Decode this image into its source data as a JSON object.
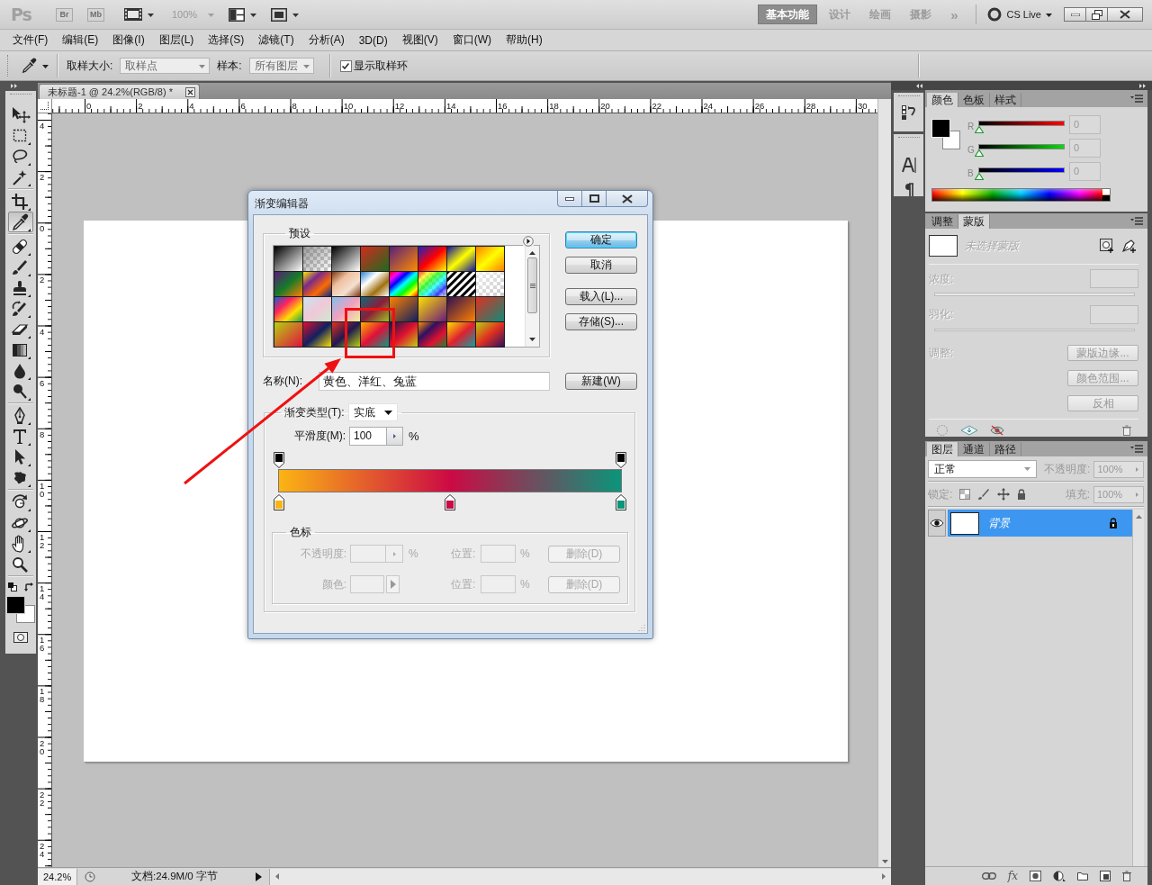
{
  "app_bar": {
    "logo": "Ps",
    "bridge_button": "Br",
    "mini_bridge_button": "Mb",
    "zoom": "100%",
    "workspaces": [
      {
        "label": "基本功能",
        "selected": true
      },
      {
        "label": "设计",
        "selected": false
      },
      {
        "label": "绘画",
        "selected": false
      },
      {
        "label": "摄影",
        "selected": false
      }
    ],
    "more_workspaces": "»",
    "cs_live": "CS Live"
  },
  "menu_bar": [
    "文件(F)",
    "编辑(E)",
    "图像(I)",
    "图层(L)",
    "选择(S)",
    "滤镜(T)",
    "分析(A)",
    "3D(D)",
    "视图(V)",
    "窗口(W)",
    "帮助(H)"
  ],
  "options_bar": {
    "sample_size_label": "取样大小:",
    "sample_size": "取样点",
    "sample_label": "样本:",
    "sample": "所有图层",
    "show_ring": {
      "label": "显示取样环",
      "checked": true
    }
  },
  "tool_groups": [
    {
      "tools": [
        {
          "kind": "move",
          "selected": false
        },
        {
          "kind": "marquee",
          "selected": false
        },
        {
          "kind": "lasso",
          "selected": false
        },
        {
          "kind": "wand",
          "selected": false
        }
      ]
    },
    {
      "tools": [
        {
          "kind": "crop",
          "selected": false
        },
        {
          "kind": "eyedropper",
          "selected": true
        }
      ]
    },
    {
      "tools": [
        {
          "kind": "healing",
          "selected": false
        },
        {
          "kind": "brush",
          "selected": false
        },
        {
          "kind": "stamp",
          "selected": false
        },
        {
          "kind": "history",
          "selected": false
        },
        {
          "kind": "eraser",
          "selected": false
        },
        {
          "kind": "gradient",
          "selected": false
        },
        {
          "kind": "blur",
          "selected": false
        },
        {
          "kind": "dodge",
          "selected": false
        }
      ]
    },
    {
      "tools": [
        {
          "kind": "pen",
          "selected": false
        },
        {
          "kind": "type",
          "selected": false
        },
        {
          "kind": "select",
          "selected": false
        },
        {
          "kind": "shape",
          "selected": false
        }
      ]
    },
    {
      "tools": [
        {
          "kind": "rotate",
          "selected": false
        },
        {
          "kind": "orbit",
          "selected": false
        },
        {
          "kind": "hand",
          "selected": false
        },
        {
          "kind": "zoom",
          "selected": false
        }
      ]
    }
  ],
  "document": {
    "tab_title": "未标题-1 @ 24.2%(RGB/8) *",
    "h_ruler": [
      "0",
      "2",
      "4",
      "6",
      "8",
      "10",
      "12",
      "14",
      "16",
      "18",
      "20",
      "22",
      "24",
      "26",
      "28",
      "30"
    ],
    "v_ruler": [
      "4",
      "2",
      "0",
      "2",
      "4",
      "6",
      "8",
      "10",
      "12",
      "14",
      "16",
      "18",
      "20",
      "22",
      "24"
    ]
  },
  "status_bar": {
    "zoom": "24.2%",
    "info": "文档:24.9M/0 字节"
  },
  "color_panel": {
    "tabs": [
      {
        "label": "颜色",
        "selected": true
      },
      {
        "label": "色板",
        "selected": false
      },
      {
        "label": "样式",
        "selected": false
      }
    ],
    "channels": [
      {
        "kind": "red",
        "label": "R",
        "value": "0",
        "level": 0
      },
      {
        "kind": "green",
        "label": "G",
        "value": "0",
        "level": 0
      },
      {
        "kind": "blue",
        "label": "B",
        "value": "0",
        "level": 0
      }
    ]
  },
  "masks_panel": {
    "tabs": [
      {
        "label": "调整",
        "selected": false
      },
      {
        "label": "蒙版",
        "selected": true
      }
    ],
    "disabled": true,
    "status": "未选择蒙版",
    "density_label": "浓度:",
    "feather_label": "羽化:",
    "refine_label": "调整:",
    "buttons": [
      "蒙版边缘...",
      "颜色范围...",
      "反相"
    ]
  },
  "layers_panel": {
    "tabs": [
      {
        "label": "图层",
        "selected": true
      },
      {
        "label": "通道",
        "selected": false
      },
      {
        "label": "路径",
        "selected": false
      }
    ],
    "blend_mode": "正常",
    "opacity": {
      "label": "不透明度:",
      "value": "100%",
      "disabled": true
    },
    "lock_label": "锁定:",
    "fill": {
      "label": "填充:",
      "value": "100%",
      "disabled": true
    },
    "layers": [
      {
        "name": "背景",
        "selected": true,
        "visible": true,
        "locked": true
      }
    ],
    "fx_button": "fx"
  },
  "gradient_editor": {
    "title": "渐变编辑器",
    "presets_label": "预设",
    "buttons": [
      {
        "label": "确定",
        "default": true
      },
      {
        "label": "取消",
        "default": false
      },
      {
        "label": "载入(L)...",
        "default": false
      },
      {
        "label": "存储(S)...",
        "default": false
      }
    ],
    "name_label": "名称(N):",
    "name": "黄色、洋红、兔蓝",
    "new_button": "新建(W)",
    "type_label": "渐变类型(T):",
    "type": "实底",
    "smoothness_label": "平滑度(M):",
    "smoothness": "100",
    "smoothness_unit": "%",
    "opacity_stops": [
      {
        "level": 0
      },
      {
        "level": 1
      }
    ],
    "color_stops": [
      {
        "level": 0,
        "color": "#fcb414"
      },
      {
        "level": 0.5,
        "color": "#cc0a44"
      },
      {
        "level": 1,
        "color": "#0b957a"
      }
    ],
    "stops_group": {
      "label": "色标",
      "disabled": true,
      "rows": [
        {
          "kind": "opacity",
          "label": "不透明度:",
          "unit": "%",
          "location_label": "位置:",
          "location_unit": "%",
          "delete_button": "删除(D)"
        },
        {
          "kind": "color",
          "label": "颜色:",
          "location_label": "位置:",
          "location_unit": "%",
          "delete_button": "删除(D)"
        }
      ]
    }
  }
}
